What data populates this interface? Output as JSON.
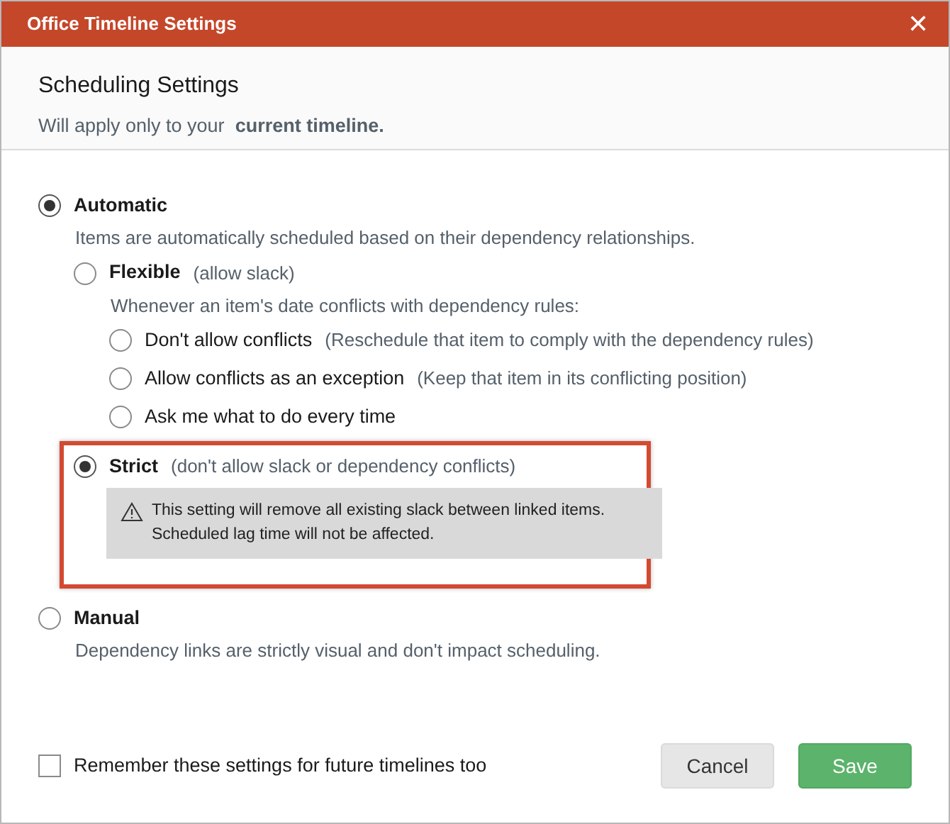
{
  "window": {
    "title": "Office Timeline Settings",
    "close": "✕"
  },
  "header": {
    "title": "Scheduling Settings",
    "subtitle": "Will apply only to your  **current timeline.**"
  },
  "options": [
    {
      "label": "Automatic",
      "selected": true,
      "description": "Items are automatically scheduled based on their dependency relationships.",
      "children": [
        {
          "label": "Flexible",
          "note": "(allow slack)",
          "selected": false,
          "description": "Whenever an item's date conflicts with dependency rules:",
          "children": [
            {
              "label": "Don't allow conflicts",
              "note": "(Reschedule that item to comply with the dependency rules)",
              "selected": false
            },
            {
              "label": "Allow conflicts as an exception",
              "note": "(Keep that item in its conflicting position)",
              "selected": false
            },
            {
              "label": "Ask me what to do every time",
              "selected": false
            }
          ]
        },
        {
          "label": "Strict",
          "note": "(don't allow slack or dependency conflicts)",
          "selected": true,
          "highlighted": true,
          "warning": "This setting will remove all existing slack between linked items.\nScheduled lag time will not be affected."
        }
      ]
    },
    {
      "label": "Manual",
      "selected": false,
      "description": "Dependency links are strictly visual and don't impact scheduling."
    }
  ],
  "remember": {
    "label": "Remember these settings for future timelines too",
    "checked": false
  },
  "buttons": [
    {
      "label": "Cancel",
      "kind": "secondary"
    },
    {
      "label": "Save",
      "kind": "primary"
    }
  ]
}
